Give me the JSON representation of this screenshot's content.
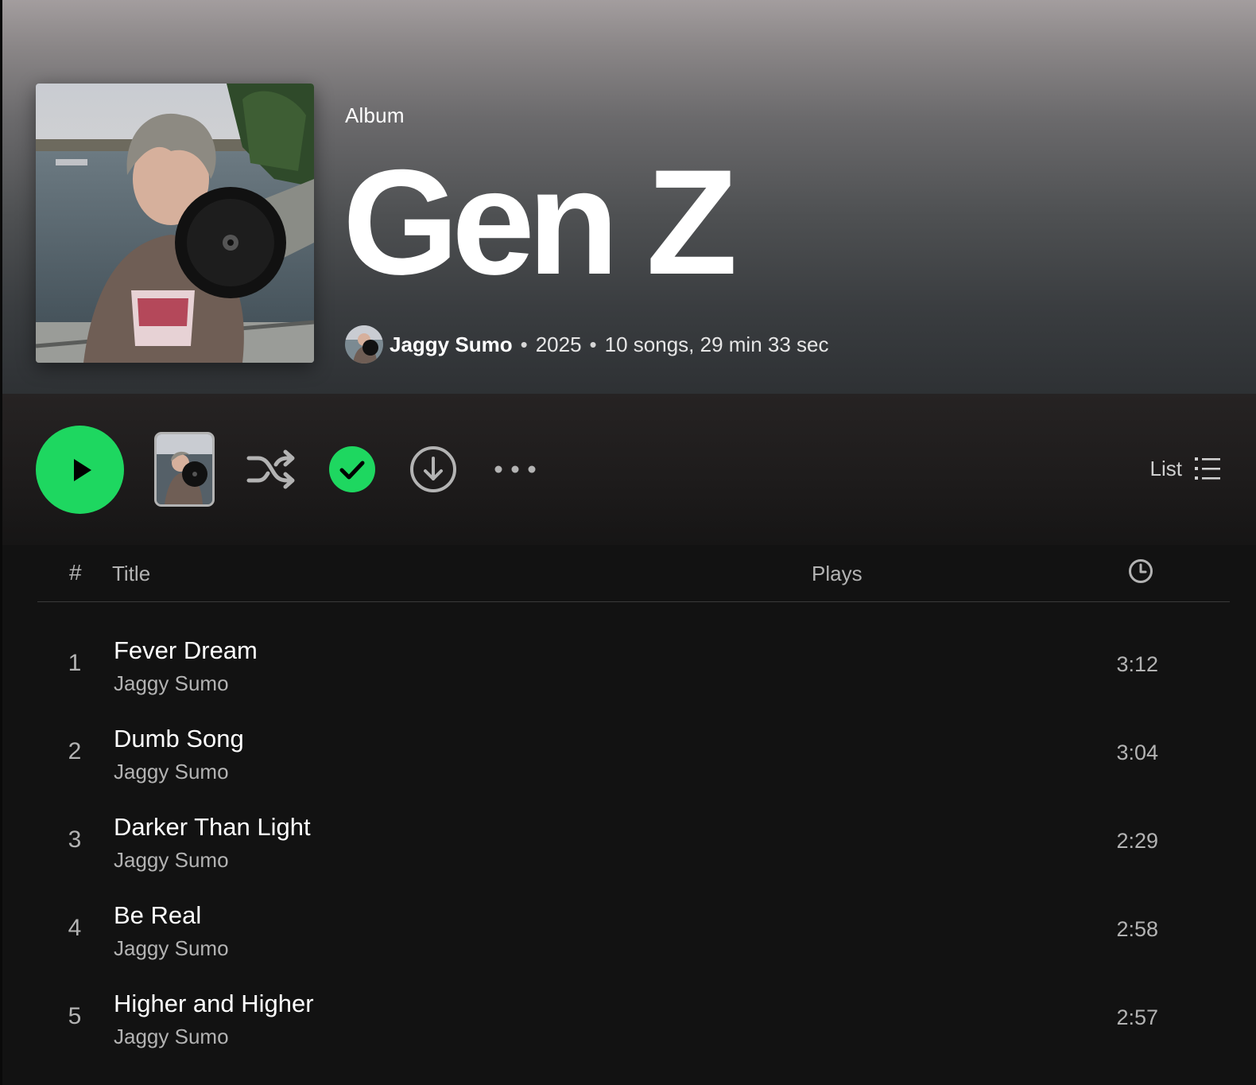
{
  "album": {
    "type_label": "Album",
    "title": "Gen Z",
    "artist": "Jaggy Sumo",
    "separator": "•",
    "year": "2025",
    "stats": "10 songs, 29 min 33 sec"
  },
  "actions": {
    "view_label": "List",
    "icons": [
      "play-icon",
      "shuffle-icon",
      "check-icon",
      "download-icon",
      "more-icon",
      "list-view-icon"
    ],
    "accent_color": "#1ed760"
  },
  "table": {
    "header_num": "#",
    "header_title": "Title",
    "header_plays": "Plays",
    "header_duration_icon": "clock-icon"
  },
  "tracks": [
    {
      "num": "1",
      "title": "Fever Dream",
      "artist": "Jaggy Sumo",
      "duration": "3:12"
    },
    {
      "num": "2",
      "title": "Dumb Song",
      "artist": "Jaggy Sumo",
      "duration": "3:04"
    },
    {
      "num": "3",
      "title": "Darker Than Light",
      "artist": "Jaggy Sumo",
      "duration": "2:29"
    },
    {
      "num": "4",
      "title": "Be Real",
      "artist": "Jaggy Sumo",
      "duration": "2:58"
    },
    {
      "num": "5",
      "title": "Higher and Higher",
      "artist": "Jaggy Sumo",
      "duration": "2:57"
    }
  ]
}
